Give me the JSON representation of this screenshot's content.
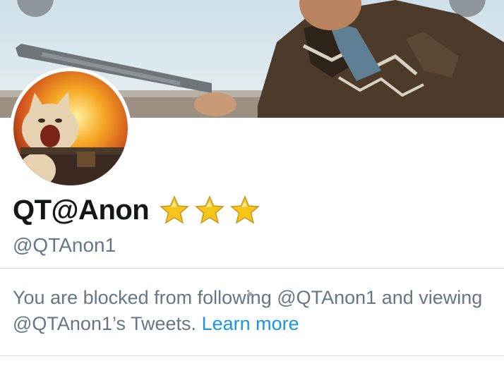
{
  "profile": {
    "display_name": "QT@Anon",
    "handle": "@QTAnon1",
    "badge_icons": [
      "star-icon",
      "star-icon",
      "star-icon"
    ]
  },
  "blocked_notice": {
    "message": "You are blocked from following @QTAnon1 and viewing @QTAnon1’s Tweets.",
    "link_label": "Learn more"
  },
  "colors": {
    "link": "#1b95e0",
    "secondary_text": "#657786",
    "primary_text": "#14171a",
    "star": "#f5c518"
  }
}
